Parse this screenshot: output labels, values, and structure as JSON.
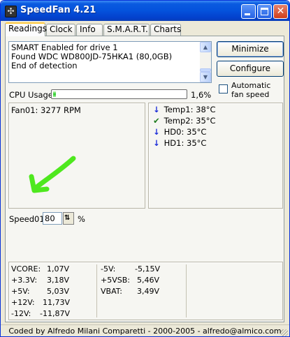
{
  "window": {
    "title": "SpeedFan 4.21"
  },
  "tabs": [
    {
      "label": "Readings",
      "active": true
    },
    {
      "label": "Clock"
    },
    {
      "label": "Info"
    },
    {
      "label": "S.M.A.R.T."
    },
    {
      "label": "Charts"
    }
  ],
  "log": {
    "lines": [
      "SMART Enabled for drive 1",
      "Found WDC WD800JD-75HKA1 (80,0GB)",
      "End of detection"
    ]
  },
  "buttons": {
    "minimize": "Minimize",
    "configure": "Configure"
  },
  "auto_fan": {
    "label": "Automatic fan speed",
    "checked": false
  },
  "cpu": {
    "label": "CPU Usage",
    "value": "1,6%",
    "percent": 1.6
  },
  "fans": [
    {
      "text": "Fan01: 3277 RPM"
    }
  ],
  "temps": [
    {
      "name": "Temp1:",
      "value": "38°C",
      "icon": "arrow-down-icon"
    },
    {
      "name": "Temp2:",
      "value": "35°C",
      "icon": "check-icon"
    },
    {
      "name": "HD0:",
      "value": "35°C",
      "icon": "arrow-down-icon"
    },
    {
      "name": "HD1:",
      "value": "35°C",
      "icon": "arrow-down-icon"
    }
  ],
  "speed": {
    "label": "Speed01:",
    "value": "80",
    "unit": "%"
  },
  "voltages": {
    "col1": [
      {
        "name": "VCORE:",
        "value": "1,07V"
      },
      {
        "name": "+3.3V:",
        "value": "3,18V"
      },
      {
        "name": "+5V:",
        "value": "5,03V"
      },
      {
        "name": "+12V:",
        "value": "11,73V"
      },
      {
        "name": "-12V:",
        "value": "-11,87V"
      }
    ],
    "col2": [
      {
        "name": "-5V:",
        "value": "-5,15V"
      },
      {
        "name": "+5VSB:",
        "value": "5,46V"
      },
      {
        "name": "VBAT:",
        "value": "3,49V"
      }
    ]
  },
  "statusbar": {
    "text": "Coded by Alfredo Milani Comparetti - 2000-2005 - alfredo@almico.com"
  },
  "colors": {
    "titlebar": "#0452dc",
    "face": "#ece9d8",
    "progress": "#2fcb2f",
    "annotation_arrow": "#4ee81e"
  }
}
